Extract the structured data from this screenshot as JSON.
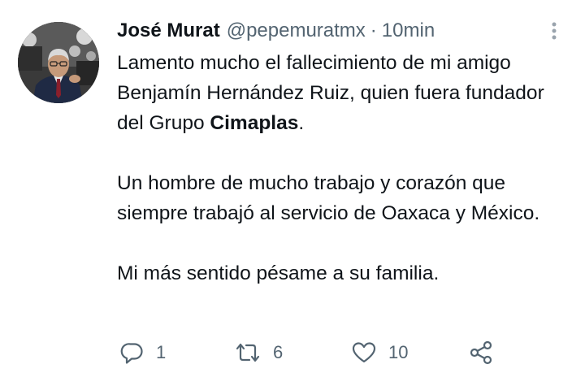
{
  "tweet": {
    "author_name": "José Murat",
    "handle": "@pepemuratmx",
    "separator": "·",
    "timestamp": "10min",
    "body": {
      "line1_prefix": "Lamento mucho el fallecimiento de mi amigo Benjamín Hernández Ruiz, quien fuera fundador del Grupo",
      "mention": "Cimaplas",
      "line1_suffix": ".",
      "paragraph2": "Un hombre de mucho trabajo y corazón que siempre trabajó al servicio de Oaxaca y México.",
      "paragraph3": "Mi más sentido pésame a su familia."
    },
    "actions": {
      "reply_count": "1",
      "retweet_count": "6",
      "like_count": "10"
    }
  },
  "icons": {
    "more": "more-vertical-icon",
    "reply": "reply-icon",
    "retweet": "retweet-icon",
    "like": "heart-icon",
    "share": "share-icon"
  },
  "colors": {
    "text_primary": "#0f1419",
    "text_secondary": "#536471",
    "background": "#ffffff"
  }
}
